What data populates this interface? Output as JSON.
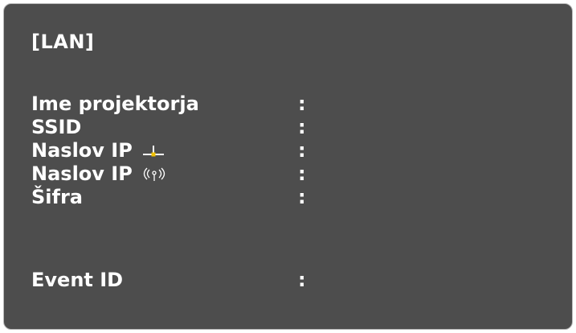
{
  "panel": {
    "title": "[LAN]",
    "rows": [
      {
        "label": "Ime projektorja",
        "separator": ":",
        "icon": null
      },
      {
        "label": "SSID",
        "separator": ":",
        "icon": null
      },
      {
        "label": "Naslov IP",
        "separator": ":",
        "icon": "wired-lan-icon"
      },
      {
        "label": "Naslov IP",
        "separator": ":",
        "icon": "wireless-lan-icon"
      },
      {
        "label": "Šifra",
        "separator": ":",
        "icon": null
      }
    ],
    "event": {
      "label": "Event ID",
      "separator": ":"
    }
  },
  "colors": {
    "background": "#4d4d4d",
    "text": "#ffffff",
    "wired_icon_accent": "#f0c000"
  }
}
